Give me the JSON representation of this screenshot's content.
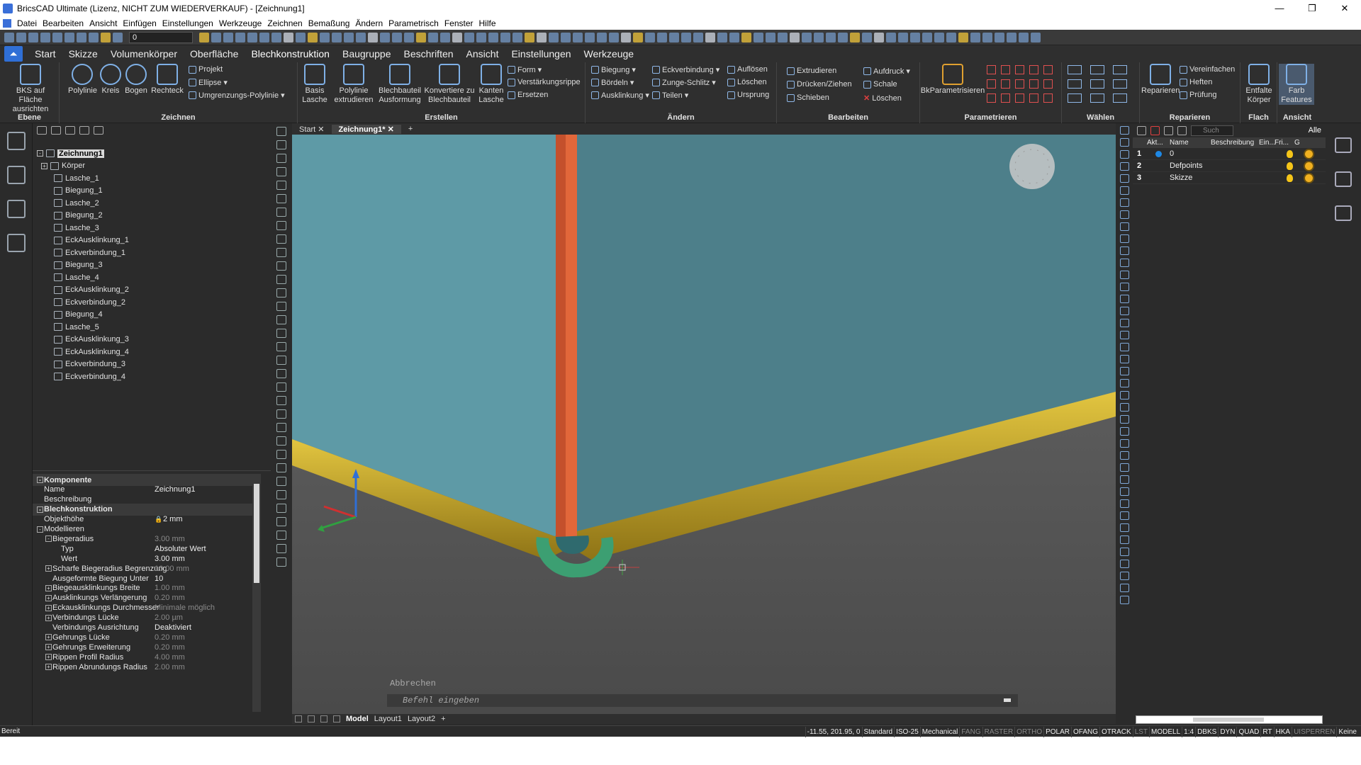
{
  "window": {
    "title": "BricsCAD Ultimate (Lizenz, NICHT ZUM WIEDERVERKAUF) - [Zeichnung1]",
    "minimize": "—",
    "maximize": "❐",
    "close": "✕"
  },
  "menu": [
    "Datei",
    "Bearbeiten",
    "Ansicht",
    "Einfügen",
    "Einstellungen",
    "Werkzeuge",
    "Zeichnen",
    "Bemaßung",
    "Ändern",
    "Parametrisch",
    "Fenster",
    "Hilfe"
  ],
  "qat": {
    "layer_value": "0"
  },
  "ribbon_tabs": [
    "Start",
    "Skizze",
    "Volumenkörper",
    "Oberfläche",
    "Blechkonstruktion",
    "Baugruppe",
    "Beschriften",
    "Ansicht",
    "Einstellungen",
    "Werkzeuge"
  ],
  "active_tab": "Blechkonstruktion",
  "ribbon": {
    "ebene": {
      "label": "Ebene",
      "bks": "BKS auf Fläche ausrichten"
    },
    "zeichnen": {
      "label": "Zeichnen",
      "polylinie": "Polylinie",
      "kreis": "Kreis",
      "bogen": "Bogen",
      "rechteck": "Rechteck",
      "projekt": "Projekt",
      "ellipse": "Ellipse",
      "umgrenzung": "Umgrenzungs-Polylinie"
    },
    "erstellen": {
      "label": "Erstellen",
      "basis": "Basis Lasche",
      "polylinie_ex": "Polylinie extrudieren",
      "ausformung": "Blechbauteil Ausformung",
      "konvertiere": "Konvertiere zu Blechbauteil",
      "kanten": "Kanten Lasche",
      "form": "Form",
      "verstaerkung": "Verstärkungsrippe",
      "ersetzen": "Ersetzen"
    },
    "aendern": {
      "label": "Ändern",
      "biegung": "Biegung",
      "boerdeln": "Bördeln",
      "ausklinkung": "Ausklinkung",
      "eckverbindung": "Eckverbindung",
      "zunge": "Zunge-Schlitz",
      "teilen": "Teilen",
      "aufloesen": "Auflösen",
      "loeschen": "Löschen",
      "ursprung": "Ursprung"
    },
    "bearbeiten": {
      "label": "Bearbeiten",
      "extrudieren": "Extrudieren",
      "druecken": "Drücken/Ziehen",
      "schieben": "Schieben",
      "aufdruck": "Aufdruck",
      "schale": "Schale",
      "loeschen": "Löschen"
    },
    "parametrieren": {
      "label": "Parametrieren",
      "bk": "BkParametrisieren"
    },
    "waehlen": {
      "label": "Wählen"
    },
    "reparieren": {
      "label": "Reparieren",
      "reparieren": "Reparieren",
      "vereinfachen": "Vereinfachen",
      "heften": "Heften",
      "pruefung": "Prüfung"
    },
    "flach": {
      "label": "Flach",
      "entfalte": "Entfalte Körper"
    },
    "ansicht": {
      "label": "Ansicht",
      "farb": "Farb Features"
    }
  },
  "browser": {
    "items": [
      {
        "label": "Zeichnung1",
        "level": 0,
        "exp": "-"
      },
      {
        "label": "Körper",
        "level": 1,
        "exp": "+"
      },
      {
        "label": "Lasche_1",
        "level": 2
      },
      {
        "label": "Biegung_1",
        "level": 2
      },
      {
        "label": "Lasche_2",
        "level": 2
      },
      {
        "label": "Biegung_2",
        "level": 2
      },
      {
        "label": "Lasche_3",
        "level": 2
      },
      {
        "label": "EckAusklinkung_1",
        "level": 2
      },
      {
        "label": "Eckverbindung_1",
        "level": 2
      },
      {
        "label": "Biegung_3",
        "level": 2
      },
      {
        "label": "Lasche_4",
        "level": 2
      },
      {
        "label": "EckAusklinkung_2",
        "level": 2
      },
      {
        "label": "Eckverbindung_2",
        "level": 2
      },
      {
        "label": "Biegung_4",
        "level": 2
      },
      {
        "label": "Lasche_5",
        "level": 2
      },
      {
        "label": "EckAusklinkung_3",
        "level": 2
      },
      {
        "label": "EckAusklinkung_4",
        "level": 2
      },
      {
        "label": "Eckverbindung_3",
        "level": 2
      },
      {
        "label": "Eckverbindung_4",
        "level": 2
      }
    ]
  },
  "properties": [
    {
      "type": "sec",
      "name": "Komponente"
    },
    {
      "name": "Name",
      "value": "Zeichnung1"
    },
    {
      "name": "Beschreibung",
      "value": ""
    },
    {
      "type": "sec",
      "name": "Blechkonstruktion"
    },
    {
      "name": "Objekthöhe",
      "value": "2 mm",
      "lock": true
    },
    {
      "type": "sec2",
      "name": "Modellieren"
    },
    {
      "name": "Biegeradius",
      "value": "3.00 mm",
      "dim": true,
      "exp": "-",
      "indent": 1
    },
    {
      "name": "Typ",
      "value": "Absoluter Wert",
      "indent": 2
    },
    {
      "name": "Wert",
      "value": "3.00 mm",
      "indent": 2
    },
    {
      "name": "Scharfe Biegeradius Begrenzung",
      "value": "10.00 mm",
      "dim": true,
      "exp": "+",
      "indent": 1
    },
    {
      "name": "Ausgeformte Biegung Unter",
      "value": "10",
      "indent": 1
    },
    {
      "name": "Biegeausklinkungs Breite",
      "value": "1.00 mm",
      "dim": true,
      "exp": "+",
      "indent": 1
    },
    {
      "name": "Ausklinkungs Verlängerung",
      "value": "0.20 mm",
      "dim": true,
      "exp": "+",
      "indent": 1
    },
    {
      "name": "Eckausklinkungs Durchmesser",
      "value": "Minimale möglich",
      "dim": true,
      "exp": "+",
      "indent": 1
    },
    {
      "name": "Verbindungs Lücke",
      "value": "2.00 µm",
      "dim": true,
      "exp": "+",
      "indent": 1
    },
    {
      "name": "Verbindungs Ausrichtung",
      "value": "Deaktiviert",
      "indent": 1
    },
    {
      "name": "Gehrungs Lücke",
      "value": "0.20 mm",
      "dim": true,
      "exp": "+",
      "indent": 1
    },
    {
      "name": "Gehrungs Erweiterung",
      "value": "0.20 mm",
      "dim": true,
      "exp": "+",
      "indent": 1
    },
    {
      "name": "Rippen Profil Radius",
      "value": "4.00 mm",
      "dim": true,
      "exp": "+",
      "indent": 1
    },
    {
      "name": "Rippen Abrundungs Radius",
      "value": "2.00 mm",
      "dim": true,
      "exp": "+",
      "indent": 1
    }
  ],
  "doc_tabs": [
    "Start",
    "Zeichnung1*"
  ],
  "layout_tabs": [
    "Model",
    "Layout1",
    "Layout2"
  ],
  "command": {
    "previous": "Abbrechen",
    "prompt": "Befehl eingeben"
  },
  "layers": {
    "search": "Such",
    "alle": "Alle",
    "headers": [
      "Akt...",
      "Name",
      "Beschreibung",
      "Ein...",
      "Fri...",
      "G"
    ],
    "rows": [
      {
        "num": "1",
        "name": "0",
        "active": true
      },
      {
        "num": "2",
        "name": "Defpoints"
      },
      {
        "num": "3",
        "name": "Skizze"
      }
    ]
  },
  "status": {
    "ready": "Bereit",
    "items": [
      {
        "t": "-11.55, 201.95, 0"
      },
      {
        "t": "Standard"
      },
      {
        "t": "ISO-25"
      },
      {
        "t": "Mechanical"
      },
      {
        "t": "FANG",
        "off": true
      },
      {
        "t": "RASTER",
        "off": true
      },
      {
        "t": "ORTHO",
        "off": true
      },
      {
        "t": "POLAR"
      },
      {
        "t": "OFANG"
      },
      {
        "t": "OTRACK"
      },
      {
        "t": "LST",
        "off": true
      },
      {
        "t": "MODELL"
      },
      {
        "t": "1:4"
      },
      {
        "t": "DBKS"
      },
      {
        "t": "DYN"
      },
      {
        "t": "QUAD"
      },
      {
        "t": "RT"
      },
      {
        "t": "HKA"
      },
      {
        "t": "UISPERREN",
        "off": true
      },
      {
        "t": "Keine"
      }
    ]
  },
  "colors": {
    "panel_left": "#5e9aa6",
    "panel_right": "#4d7f8a",
    "tube": "#c9a92f",
    "orange": "#e2673a",
    "green": "#3c9f72",
    "floor": "#525252"
  }
}
